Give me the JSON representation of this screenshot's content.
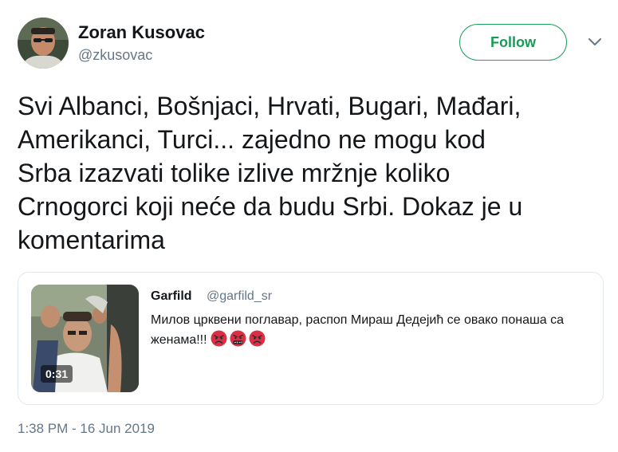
{
  "author": {
    "name": "Zoran Kusovac",
    "handle": "@zkusovac"
  },
  "actions": {
    "follow_label": "Follow",
    "menu_icon": "chevron-down-icon"
  },
  "tweet": {
    "text": "Svi Albanci, Bošnjaci, Hrvati, Bugari, Mađari,\nAmerikanci, Turci... zajedno ne mogu kod\nSrba izazvati tolike izlive mržnje koliko\nCrnogorci koji neće da budu Srbi. Dokaz je u\nkomentarima",
    "timestamp": "1:38 PM - 16 Jun 2019"
  },
  "quote": {
    "name": "Garfild",
    "handle": "@garfild_sr",
    "text": "Милов црквени поглавар, распоп Мираш Дедејић се овако понаша са женама!!!",
    "emojis": [
      "angry-face-icon",
      "face-with-symbols-icon",
      "angry-face-icon"
    ],
    "video_duration": "0:31"
  },
  "colors": {
    "follow_green": "#1da35f",
    "muted_text": "#657786",
    "border": "#e1e8ed"
  }
}
